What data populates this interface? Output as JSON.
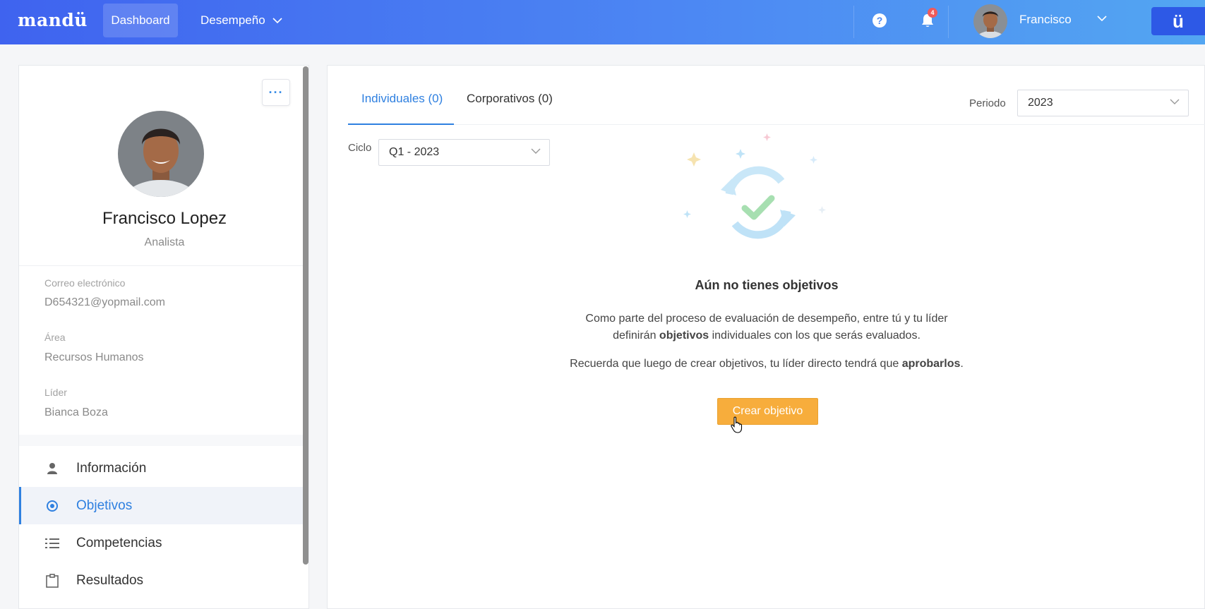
{
  "topbar": {
    "logo": "mandü",
    "nav": {
      "dashboard": "Dashboard",
      "desempeno": "Desempeño"
    },
    "help_symbol": "?",
    "notifications_count": "4",
    "user_name": "Francisco",
    "brand_glyph": "ü",
    "icons": [
      "help-icon",
      "bell-icon",
      "chevron-down-icon"
    ]
  },
  "profile": {
    "name": "Francisco Lopez",
    "role": "Analista",
    "more_label": "···",
    "fields": [
      {
        "label": "Correo electrónico",
        "value": "D654321@yopmail.com"
      },
      {
        "label": "Área",
        "value": "Recursos Humanos"
      },
      {
        "label": "Líder",
        "value": "Bianca Boza"
      }
    ]
  },
  "menu": {
    "items": [
      {
        "label": "Información",
        "icon": "user-icon"
      },
      {
        "label": "Objetivos",
        "icon": "target-icon",
        "active": true
      },
      {
        "label": "Competencias",
        "icon": "list-icon"
      },
      {
        "label": "Resultados",
        "icon": "clipboard-icon"
      }
    ]
  },
  "main": {
    "tabs": {
      "individuales": "Individuales (0)",
      "corporativos": "Corporativos (0)"
    },
    "periodo": {
      "label": "Periodo",
      "value": "2023"
    },
    "ciclo": {
      "label": "Ciclo",
      "value": "Q1 - 2023"
    },
    "empty": {
      "title": "Aún no tienes objetivos",
      "p1_a": "Como parte del proceso de evaluación de desempeño, entre tú y tu líder",
      "p1_b_pre": "definirán ",
      "p1_b_bold": "objetivos",
      "p1_b_post": " individuales con los que serás evaluados.",
      "p2_pre": "Recuerda que luego de crear objetivos, tu líder directo tendrá que ",
      "p2_bold": "aprobarlos",
      "p2_post": ".",
      "cta": "Crear objetivo"
    }
  },
  "colors": {
    "accent": "#2f80e0",
    "cta": "#f7ad3c",
    "topbar_start": "#3f63ef",
    "topbar_end": "#53a6f2"
  }
}
